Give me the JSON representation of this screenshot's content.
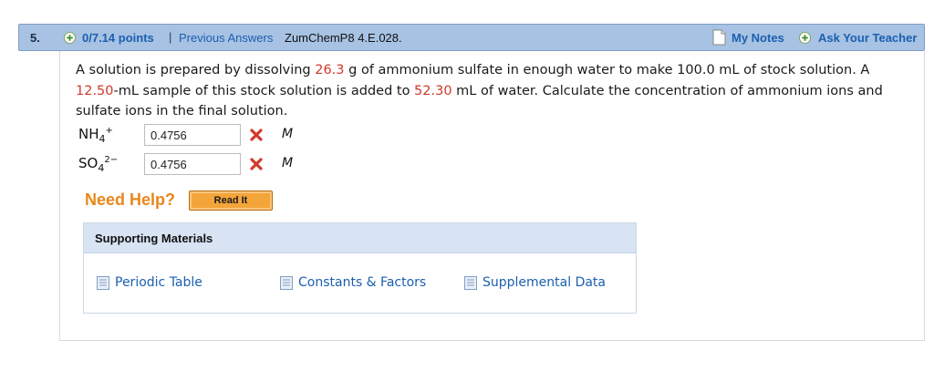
{
  "question_header": {
    "number": "5.",
    "points": "0/7.14 points",
    "separator": "|",
    "previous_answers": "Previous Answers",
    "code": "ZumChemP8 4.E.028.",
    "my_notes": "My Notes",
    "ask_teacher": "Ask Your Teacher"
  },
  "question": {
    "t1": "A solution is prepared by dissolving ",
    "mass": "26.3",
    "t2": " g of ammonium sulfate in enough water to make 100.0 mL of stock solution. A ",
    "sample_volume": "12.50",
    "t3": "-mL sample of this stock solution is added to ",
    "water_volume": "52.30",
    "t4": " mL of water. Calculate the concentration of ammonium ions and sulfate ions in the final solution."
  },
  "answers": [
    {
      "label_base": "NH",
      "label_sub": "4",
      "label_sup": "+",
      "value": "0.4756",
      "unit": "M",
      "status": "incorrect"
    },
    {
      "label_base": "SO",
      "label_sub": "4",
      "label_sup": "2−",
      "value": "0.4756",
      "unit": "M",
      "status": "incorrect"
    }
  ],
  "help": {
    "need_help": "Need Help?",
    "read_it": "Read It"
  },
  "supporting": {
    "title": "Supporting Materials",
    "items": [
      "Periodic Table",
      "Constants & Factors",
      "Supplemental Data"
    ]
  },
  "colors": {
    "header_bg": "#a7c2e3",
    "link": "#1b5fb0",
    "highlight": "#d0392b",
    "need_help": "#e8871a",
    "read_it_bg": "#f4a53a"
  }
}
